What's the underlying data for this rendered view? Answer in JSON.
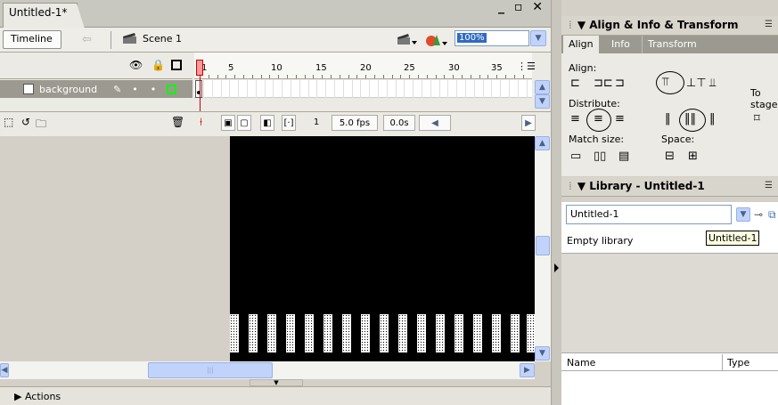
{
  "document": {
    "tab_title": "Untitled-1*",
    "window_controls": "_ ▫ ✕"
  },
  "editbar": {
    "timeline_label": "Timeline",
    "scene_label": "Scene 1",
    "zoom": "100%"
  },
  "timeline": {
    "frame_numbers": [
      "1",
      "5",
      "10",
      "15",
      "20",
      "25",
      "30",
      "35"
    ],
    "layer_name": "background",
    "current_frame": "1",
    "frame_rate": "5.0 fps",
    "elapsed": "0.0s"
  },
  "actions_label": "Actions",
  "align_panel": {
    "title": "Align & Info & Transform",
    "tabs": [
      "Align",
      "Info",
      "Transform"
    ],
    "align_label": "Align:",
    "distribute_label": "Distribute:",
    "match_size_label": "Match size:",
    "space_label": "Space:",
    "to_stage_label": "To stage:"
  },
  "library_panel": {
    "title": "Library - Untitled-1",
    "selected_doc": "Untitled-1",
    "tooltip": "Untitled-1",
    "empty_text": "Empty library",
    "col_name": "Name",
    "col_type": "Type"
  },
  "colors": {
    "stage": "#000000",
    "selection": "#316ac5",
    "layer_row": "#9c9a90"
  }
}
